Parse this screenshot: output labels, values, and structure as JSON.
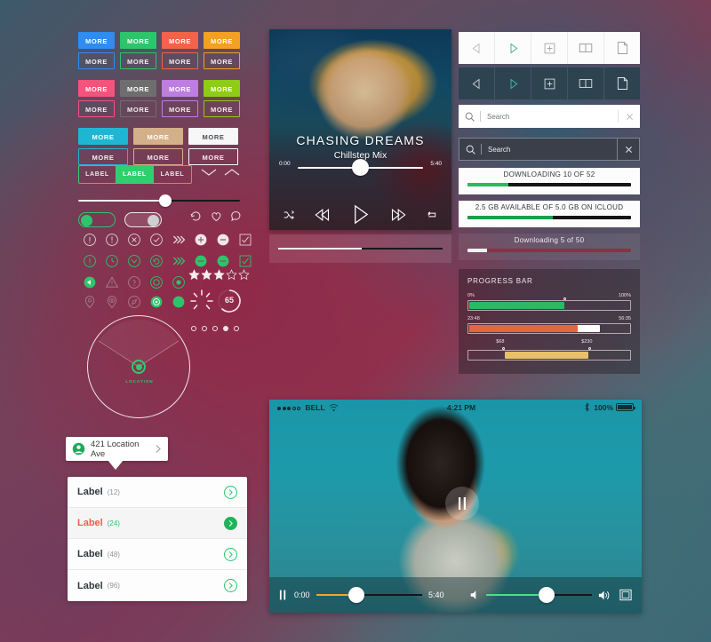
{
  "buttons": {
    "label": "MORE",
    "rows": [
      [
        {
          "color": "#2f8cf0"
        },
        {
          "color": "#2ec46b"
        },
        {
          "color": "#f46247"
        },
        {
          "color": "#f2a122"
        }
      ],
      [
        {
          "color": "#f4537c"
        },
        {
          "color": "#6e6e6e"
        },
        {
          "color": "#bd7ee0"
        },
        {
          "color": "#8fcc17"
        }
      ],
      [
        {
          "color": "#1fb6d4"
        },
        {
          "color": "#d3b08a"
        },
        {
          "color": "#f7f7f7"
        }
      ]
    ]
  },
  "segmented": {
    "items": [
      {
        "label": "LABEL",
        "active": false
      },
      {
        "label": "LABEL",
        "active": true
      },
      {
        "label": "LABEL",
        "active": false
      }
    ]
  },
  "slider": {
    "value_pct": 54
  },
  "toggles": [
    {
      "state": "on"
    },
    {
      "state": "off"
    }
  ],
  "social_icons": [
    "refresh-icon",
    "heart-icon",
    "comment-icon"
  ],
  "icon_grid": {
    "row1": [
      "info-circle-icon",
      "exclamation-circle-icon",
      "close-circle-icon",
      "check-circle-icon",
      "chevrons-right-icon",
      "plus-circle-icon",
      "minus-circle-icon",
      "checkbox-checked-icon"
    ],
    "row2": [
      "info-circle-icon",
      "clock-circle-icon",
      "down-circle-icon",
      "refresh-circle-icon",
      "chevrons-right-icon",
      "minus-circle-icon",
      "minus-circle-icon",
      "checkbox-checked-icon"
    ],
    "row3": [
      "volume-circle-icon",
      "warning-triangle-icon",
      "question-circle-icon",
      "record-circle-icon",
      "radio-selected-icon"
    ],
    "row4": [
      "map-pin-icon",
      "target-pin-icon",
      "compass-icon",
      "location-dot-icon",
      "location-filled-icon"
    ]
  },
  "rating": {
    "filled": 3,
    "total": 5
  },
  "gauge": {
    "value": "65"
  },
  "radial": {
    "label": "LOCATION"
  },
  "pagination": {
    "total": 5,
    "active_index": 3
  },
  "callout": {
    "label": "421 Location Ave",
    "icon": "user-circle-icon",
    "chevron": "chevron-right-icon"
  },
  "list": {
    "rows": [
      {
        "label": "Label",
        "count": "(12)",
        "selected": false
      },
      {
        "label": "Label",
        "count": "(24)",
        "selected": true
      },
      {
        "label": "Label",
        "count": "(48)",
        "selected": false
      },
      {
        "label": "Label",
        "count": "(96)",
        "selected": false
      }
    ]
  },
  "music_player": {
    "title": "CHASING DREAMS",
    "subtitle": "Chillstep Mix",
    "time_current": "0:00",
    "time_total": "5:40",
    "progress_pct": 50,
    "volume_pct": 50,
    "controls": [
      "shuffle-icon",
      "previous-icon",
      "play-icon",
      "next-icon",
      "repeat-icon"
    ],
    "bottom_bar_pct": 51
  },
  "toolbar_light": {
    "items": [
      "back-arrow-icon",
      "forward-arrow-icon",
      "plus-box-icon",
      "book-icon",
      "page-icon"
    ]
  },
  "toolbar_dark": {
    "items": [
      "back-arrow-icon",
      "forward-arrow-icon",
      "plus-box-icon",
      "book-icon",
      "page-icon"
    ]
  },
  "search_light": {
    "placeholder": "Search",
    "icon": "search-icon",
    "clear": "clear-icon"
  },
  "search_dark": {
    "placeholder": "Search",
    "icon": "search-icon",
    "clear": "clear-icon"
  },
  "downloads": [
    {
      "text": "DOWNLOADING 10 OF 52",
      "pct": 25,
      "fill": "#2bb95e",
      "theme": "light"
    },
    {
      "text": "2.5 GB AVAILABLE OF 5.0 GB ON ICLOUD",
      "pct": 52,
      "fill": "#1e9e4a",
      "theme": "light"
    },
    {
      "text": "Downloading  5  of 50",
      "pct": 12,
      "fill": "#f2f2f2",
      "theme": "dark"
    }
  ],
  "progress_card": {
    "title": "PROGRESS BAR",
    "bars": [
      {
        "left_label": "0%",
        "right_label": "100%",
        "pct": 60,
        "color": "#2eb862",
        "track": "transparent",
        "pin": true
      },
      {
        "left_label": "23:48",
        "right_label": "56:35",
        "pct": 68,
        "color": "#e2683a",
        "secondary_pct": 82,
        "secondary_color": "#ffffff",
        "pin": false
      },
      {
        "left_label": "$68",
        "right_label": "$230",
        "pct_start": 22,
        "pct_end": 75,
        "color": "#e8c06a",
        "pin": true
      }
    ]
  },
  "video_player": {
    "status": {
      "carrier": "BELL",
      "time": "4:21 PM",
      "battery": "100%",
      "wifi_icon": "wifi-icon",
      "bluetooth_icon": "bluetooth-icon"
    },
    "time_current": "0:00",
    "time_total": "5:40",
    "progress_pct": 38,
    "volume_pct": 57,
    "pause_icon": "pause-icon",
    "fullscreen_icon": "fullscreen-icon",
    "volume_low_icon": "volume-low-icon",
    "volume_high_icon": "volume-high-icon"
  },
  "colors": {
    "accent_green": "#2ec46b",
    "accent_teal": "#1fb6d4",
    "accent_red": "#e8604c",
    "dark_toolbar": "#2d4350"
  }
}
